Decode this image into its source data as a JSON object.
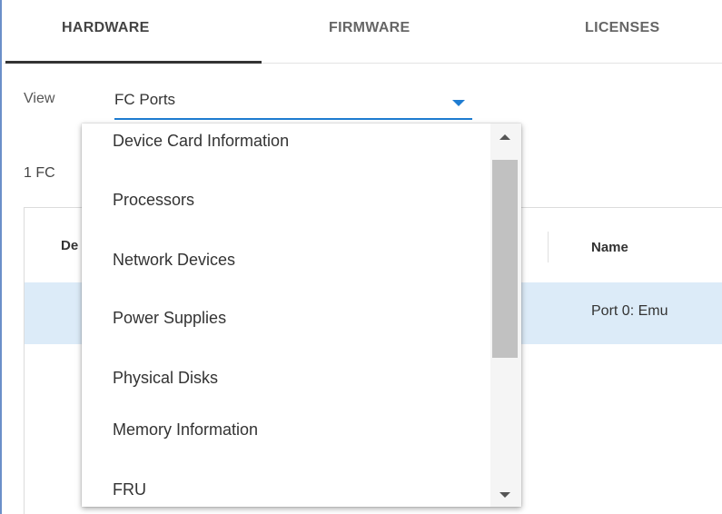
{
  "tabs": {
    "hardware": "HARDWARE",
    "firmware": "FIRMWARE",
    "licenses": "LICENSES",
    "active": "HARDWARE"
  },
  "view": {
    "label": "View",
    "selected": "FC Ports"
  },
  "count_text": "1 FC",
  "table": {
    "col_device": "De",
    "col_name": "Name",
    "row_name": "Port 0: Emu"
  },
  "dropdown": {
    "options": [
      "Device Card Information",
      "Processors",
      "Network Devices",
      "Power Supplies",
      "Physical Disks",
      "Memory Information",
      "FRU"
    ]
  },
  "colors": {
    "accent": "#1f7cd1",
    "selected_row": "#dcebf8",
    "scroll_thumb": "#c1c1c1"
  },
  "icons": {
    "select_caret": "caret-down-icon",
    "scroll_up": "arrow-up-icon",
    "scroll_down": "arrow-down-icon"
  }
}
